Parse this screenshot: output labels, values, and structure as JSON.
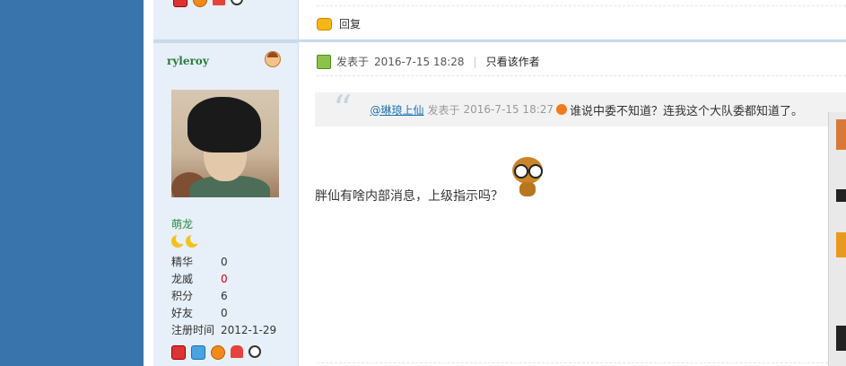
{
  "post": {
    "reply_label": "回复",
    "posted_label": "发表于",
    "posted_time": "2016-7-15 18:28",
    "only_author_label": "只看该作者",
    "quote": {
      "mention": "@琳琅上仙",
      "posted_label": "发表于",
      "posted_time": "2016-7-15 18:27",
      "text": "谁说中委不知道？连我这个大队委都知道了。"
    },
    "body": "胖仙有啥内部消息，上级指示吗？"
  },
  "user": {
    "name": "ryleroy",
    "rank": "萌龙",
    "stats": [
      {
        "label": "精华",
        "value": "0"
      },
      {
        "label": "龙威",
        "value": "0"
      },
      {
        "label": "积分",
        "value": "6"
      },
      {
        "label": "好友",
        "value": "0"
      },
      {
        "label": "注册时间",
        "value": "2012-1-29"
      }
    ]
  },
  "colors": {
    "sidebar_bg": "#e7eff8",
    "left_band": "#3a74ad",
    "username": "#2b7a3b",
    "link": "#1a6fb0",
    "red_value": "#d00"
  }
}
